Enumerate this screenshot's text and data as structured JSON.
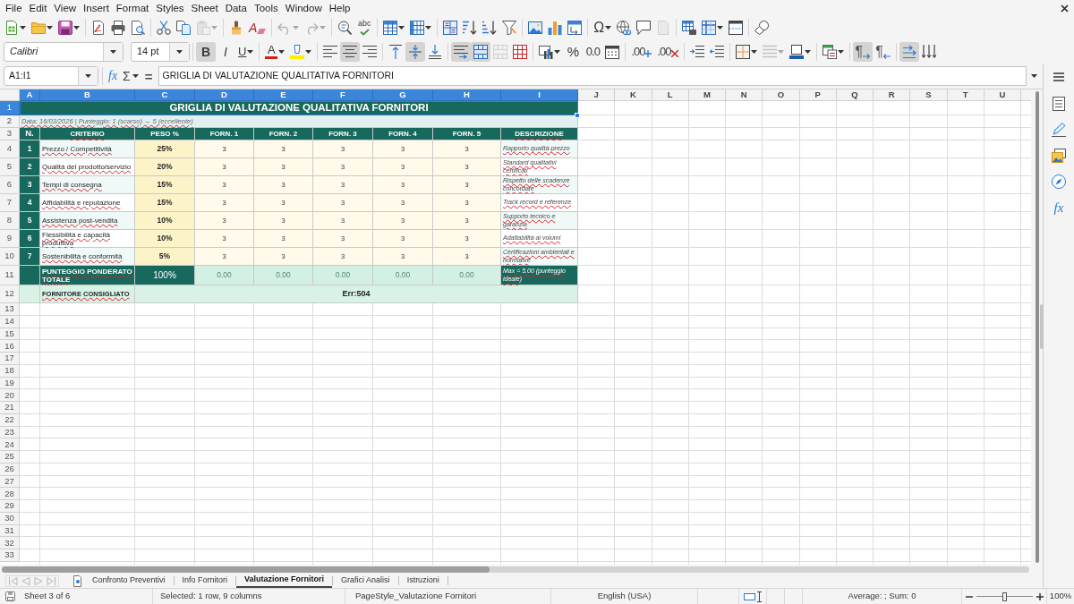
{
  "menu_bar": [
    "File",
    "Edit",
    "View",
    "Insert",
    "Format",
    "Styles",
    "Sheet",
    "Data",
    "Tools",
    "Window",
    "Help"
  ],
  "standard_toolbar": [
    [
      {
        "kind": "new",
        "disabled": false
      },
      {
        "kind": "open",
        "disabled": false
      },
      {
        "kind": "save",
        "disabled": false
      }
    ],
    [
      {
        "kind": "export_pdf",
        "disabled": false
      },
      {
        "kind": "print",
        "disabled": false
      },
      {
        "kind": "print_preview",
        "disabled": false
      }
    ],
    [
      {
        "kind": "cut",
        "disabled": false
      },
      {
        "kind": "copy",
        "disabled": false
      },
      {
        "kind": "paste",
        "disabled": true
      }
    ],
    [
      {
        "kind": "clone_formatting",
        "disabled": false
      },
      {
        "kind": "clear_formatting",
        "label": "A",
        "disabled": false
      }
    ],
    [
      {
        "kind": "undo",
        "disabled": true
      },
      {
        "kind": "redo",
        "disabled": true
      }
    ],
    [
      {
        "kind": "find_replace",
        "disabled": false
      },
      {
        "kind": "spelling",
        "label": "abc",
        "disabled": false
      }
    ],
    [
      {
        "kind": "row",
        "disabled": false
      },
      {
        "kind": "column",
        "disabled": false
      }
    ],
    [
      {
        "kind": "sort",
        "disabled": false
      },
      {
        "kind": "sort_ascending",
        "disabled": false
      },
      {
        "kind": "sort_descending",
        "disabled": false
      },
      {
        "kind": "autofilter",
        "disabled": false
      }
    ],
    [
      {
        "kind": "image",
        "disabled": false
      },
      {
        "kind": "chart",
        "disabled": false
      },
      {
        "kind": "pivot_table",
        "disabled": false
      }
    ],
    [
      {
        "kind": "special_character",
        "label": "Ω",
        "disabled": false
      },
      {
        "kind": "hyperlink",
        "disabled": false
      },
      {
        "kind": "comment",
        "disabled": false
      },
      {
        "kind": "headers_footers",
        "disabled": true
      }
    ],
    [
      {
        "kind": "print_area",
        "disabled": false
      },
      {
        "kind": "freeze",
        "disabled": false
      },
      {
        "kind": "split_window",
        "disabled": false
      }
    ],
    [
      {
        "kind": "shapes",
        "disabled": false
      }
    ]
  ],
  "formatting_toolbar": {
    "font_name": "Calibri",
    "font_size": "14 pt",
    "groups": [
      [
        {
          "kind": "bold",
          "label": "B",
          "pressed": true,
          "disabled": false
        },
        {
          "kind": "italic",
          "label": "I",
          "pressed": false,
          "disabled": false
        },
        {
          "kind": "underline",
          "label": "U",
          "pressed": false,
          "disabled": false
        }
      ],
      [
        {
          "kind": "font_color",
          "label": "A",
          "pressed": false,
          "disabled": false
        },
        {
          "kind": "highlight",
          "pressed": false,
          "disabled": false
        }
      ],
      [
        {
          "kind": "align_left",
          "pressed": false,
          "disabled": false
        },
        {
          "kind": "align_center",
          "pressed": true,
          "disabled": false
        },
        {
          "kind": "align_right",
          "pressed": false,
          "disabled": false
        }
      ],
      [
        {
          "kind": "align_top",
          "pressed": false,
          "disabled": false
        },
        {
          "kind": "align_middle",
          "pressed": true,
          "disabled": false
        },
        {
          "kind": "align_bottom",
          "pressed": false,
          "disabled": false
        }
      ],
      [
        {
          "kind": "wrap_text",
          "pressed": true,
          "disabled": false
        },
        {
          "kind": "merge_center",
          "pressed": true,
          "disabled": false
        },
        {
          "kind": "merge",
          "pressed": false,
          "disabled": true
        },
        {
          "kind": "unmerge",
          "pressed": false,
          "disabled": false
        }
      ],
      [
        {
          "kind": "number_format",
          "pressed": false,
          "disabled": false
        },
        {
          "kind": "percent",
          "label": "%",
          "pressed": false,
          "disabled": false
        },
        {
          "kind": "decimal",
          "label": "0.0",
          "pressed": false,
          "disabled": false
        },
        {
          "kind": "date",
          "pressed": false,
          "disabled": false
        }
      ],
      [
        {
          "kind": "add_decimal",
          "label": ".00",
          "pressed": false,
          "disabled": false
        },
        {
          "kind": "delete_decimal",
          "label": ".00",
          "pressed": false,
          "disabled": false
        }
      ],
      [
        {
          "kind": "indent_more",
          "pressed": false,
          "disabled": false
        },
        {
          "kind": "indent_less",
          "pressed": false,
          "disabled": false
        }
      ],
      [
        {
          "kind": "borders",
          "pressed": false,
          "disabled": false
        },
        {
          "kind": "border_style",
          "pressed": false,
          "disabled": true
        },
        {
          "kind": "border_color",
          "pressed": false,
          "disabled": false
        }
      ],
      [
        {
          "kind": "conditional",
          "pressed": false,
          "disabled": false
        }
      ],
      [
        {
          "kind": "left_to_right",
          "label": "¶",
          "pressed": true,
          "disabled": false
        },
        {
          "kind": "right_to_left",
          "label": "¶",
          "pressed": false,
          "disabled": false
        }
      ],
      [
        {
          "kind": "text_direction",
          "pressed": true,
          "disabled": false
        },
        {
          "kind": "vertical_text",
          "pressed": false,
          "disabled": false
        }
      ]
    ]
  },
  "formula_bar": {
    "name_box": "A1:I1",
    "function_wizard": "fx",
    "sum": "Σ",
    "equals": "=",
    "content": "GRIGLIA DI VALUTAZIONE QUALITATIVA FORNITORI"
  },
  "sheet": {
    "columns": [
      {
        "label": "A",
        "selected": true
      },
      {
        "label": "B",
        "selected": true
      },
      {
        "label": "C",
        "selected": true
      },
      {
        "label": "D",
        "selected": true
      },
      {
        "label": "E",
        "selected": true
      },
      {
        "label": "F",
        "selected": true
      },
      {
        "label": "G",
        "selected": true
      },
      {
        "label": "H",
        "selected": true
      },
      {
        "label": "I",
        "selected": true
      },
      {
        "label": "J",
        "selected": false
      },
      {
        "label": "K",
        "selected": false
      },
      {
        "label": "L",
        "selected": false
      },
      {
        "label": "M",
        "selected": false
      },
      {
        "label": "N",
        "selected": false
      },
      {
        "label": "O",
        "selected": false
      },
      {
        "label": "P",
        "selected": false
      },
      {
        "label": "Q",
        "selected": false
      },
      {
        "label": "R",
        "selected": false
      },
      {
        "label": "S",
        "selected": false
      },
      {
        "label": "T",
        "selected": false
      },
      {
        "label": "U",
        "selected": false
      }
    ],
    "rows": [
      {
        "label": "1",
        "selected": true
      },
      {
        "label": "2",
        "selected": false
      },
      {
        "label": "3",
        "selected": false
      },
      {
        "label": "4",
        "selected": false
      },
      {
        "label": "5",
        "selected": false
      },
      {
        "label": "6",
        "selected": false
      },
      {
        "label": "7",
        "selected": false
      },
      {
        "label": "8",
        "selected": false
      },
      {
        "label": "9",
        "selected": false
      },
      {
        "label": "10",
        "selected": false
      },
      {
        "label": "11",
        "selected": false
      },
      {
        "label": "12",
        "selected": false
      },
      {
        "label": "13",
        "selected": false
      },
      {
        "label": "14",
        "selected": false
      },
      {
        "label": "15",
        "selected": false
      },
      {
        "label": "16",
        "selected": false
      },
      {
        "label": "17",
        "selected": false
      },
      {
        "label": "18",
        "selected": false
      },
      {
        "label": "19",
        "selected": false
      },
      {
        "label": "20",
        "selected": false
      },
      {
        "label": "21",
        "selected": false
      },
      {
        "label": "22",
        "selected": false
      },
      {
        "label": "23",
        "selected": false
      },
      {
        "label": "24",
        "selected": false
      },
      {
        "label": "25",
        "selected": false
      },
      {
        "label": "26",
        "selected": false
      },
      {
        "label": "27",
        "selected": false
      },
      {
        "label": "28",
        "selected": false
      },
      {
        "label": "29",
        "selected": false
      },
      {
        "label": "30",
        "selected": false
      },
      {
        "label": "31",
        "selected": false
      },
      {
        "label": "32",
        "selected": false
      },
      {
        "label": "33",
        "selected": false
      }
    ],
    "title": {
      "text": "GRIGLIA DI VALUTAZIONE QUALITATIVA FORNITORI",
      "selected": true
    },
    "subtitle": {
      "text": "Data: 16/03/2026 | Punteggio: 1 (scarso) → 5 (eccellente)",
      "misspelled": true
    },
    "header": [
      {
        "text": "N.",
        "misspelled": false
      },
      {
        "text": "CRITERIO",
        "misspelled": true
      },
      {
        "text": "PESO %",
        "misspelled": false
      },
      {
        "text": "FORN. 1",
        "misspelled": false
      },
      {
        "text": "FORN. 2",
        "misspelled": false
      },
      {
        "text": "FORN. 3",
        "misspelled": false
      },
      {
        "text": "FORN. 4",
        "misspelled": false
      },
      {
        "text": "FORN. 5",
        "misspelled": false
      },
      {
        "text": "DESCRIZIONE",
        "misspelled": true
      }
    ],
    "criteria": [
      {
        "number": "1",
        "name": "Prezzo / Competitività",
        "name_misspelled": true,
        "weight": "25%",
        "scores": [
          "3",
          "3",
          "3",
          "3",
          "3"
        ],
        "description": "Rapporto qualità-prezzo",
        "description_misspelled": true
      },
      {
        "number": "2",
        "name": "Qualità del prodotto/servizio",
        "name_misspelled": true,
        "weight": "20%",
        "scores": [
          "3",
          "3",
          "3",
          "3",
          "3"
        ],
        "description": "Standard qualitativi certificati",
        "description_misspelled": true
      },
      {
        "number": "3",
        "name": "Tempi di consegna",
        "name_misspelled": true,
        "weight": "15%",
        "scores": [
          "3",
          "3",
          "3",
          "3",
          "3"
        ],
        "description": "Rispetto delle scadenze concordate",
        "description_misspelled": true
      },
      {
        "number": "4",
        "name": "Affidabilità e reputazione",
        "name_misspelled": true,
        "weight": "15%",
        "scores": [
          "3",
          "3",
          "3",
          "3",
          "3"
        ],
        "description": "Track record e referenze",
        "description_misspelled": true
      },
      {
        "number": "5",
        "name": "Assistenza post-vendita",
        "name_misspelled": true,
        "weight": "10%",
        "scores": [
          "3",
          "3",
          "3",
          "3",
          "3"
        ],
        "description": "Supporto tecnico e garanzia",
        "description_misspelled": true
      },
      {
        "number": "6",
        "name": "Flessibilità e capacità produttiva",
        "name_misspelled": true,
        "weight": "10%",
        "scores": [
          "3",
          "3",
          "3",
          "3",
          "3"
        ],
        "description": "Adattabilità ai volumi",
        "description_misspelled": true
      },
      {
        "number": "7",
        "name": "Sostenibilità e conformità",
        "name_misspelled": true,
        "weight": "5%",
        "scores": [
          "3",
          "3",
          "3",
          "3",
          "3"
        ],
        "description": "Certificazioni ambientali e normative",
        "description_misspelled": true
      }
    ],
    "total": {
      "label": "PUNTEGGIO PONDERATO TOTALE",
      "label_misspelled": true,
      "weight": "100%",
      "scores": [
        "0.00",
        "0.00",
        "0.00",
        "0.00",
        "0.00"
      ],
      "note": "Max = 5.00 (punteggio ideale)",
      "note_misspelled": true
    },
    "recommendation": {
      "label": "FORNITORE CONSIGLIATO",
      "label_misspelled": true,
      "value": "Err:504"
    }
  },
  "sheet_tabs": {
    "navigation": [
      {
        "kind": "first",
        "disabled": true
      },
      {
        "kind": "previous",
        "disabled": true
      },
      {
        "kind": "next",
        "disabled": true
      },
      {
        "kind": "last",
        "disabled": true
      }
    ],
    "tabs": [
      {
        "label": "Confronto Preventivi",
        "selected": false
      },
      {
        "label": "Info Fornitori",
        "selected": false
      },
      {
        "label": "Valutazione Fornitori",
        "selected": true
      },
      {
        "label": "Grafici Analisi",
        "selected": false
      },
      {
        "label": "Istruzioni",
        "selected": false
      }
    ]
  },
  "sidebar": [
    {
      "kind": "properties",
      "selected": false
    },
    {
      "kind": "styles",
      "selected": false
    },
    {
      "kind": "gallery",
      "selected": false
    },
    {
      "kind": "navigator",
      "selected": false
    },
    {
      "kind": "functions",
      "label": "fx",
      "selected": false
    }
  ],
  "status_bar": {
    "sheet": "Sheet 3 of 6",
    "selection": "Selected: 1 row, 9 columns",
    "page_style": "PageStyle_Valutazione Fornitori",
    "language": "English (USA)",
    "summary": "Average: ; Sum: 0",
    "zoom_slider": {
      "level": 0.5
    },
    "zoom": "100%"
  }
}
